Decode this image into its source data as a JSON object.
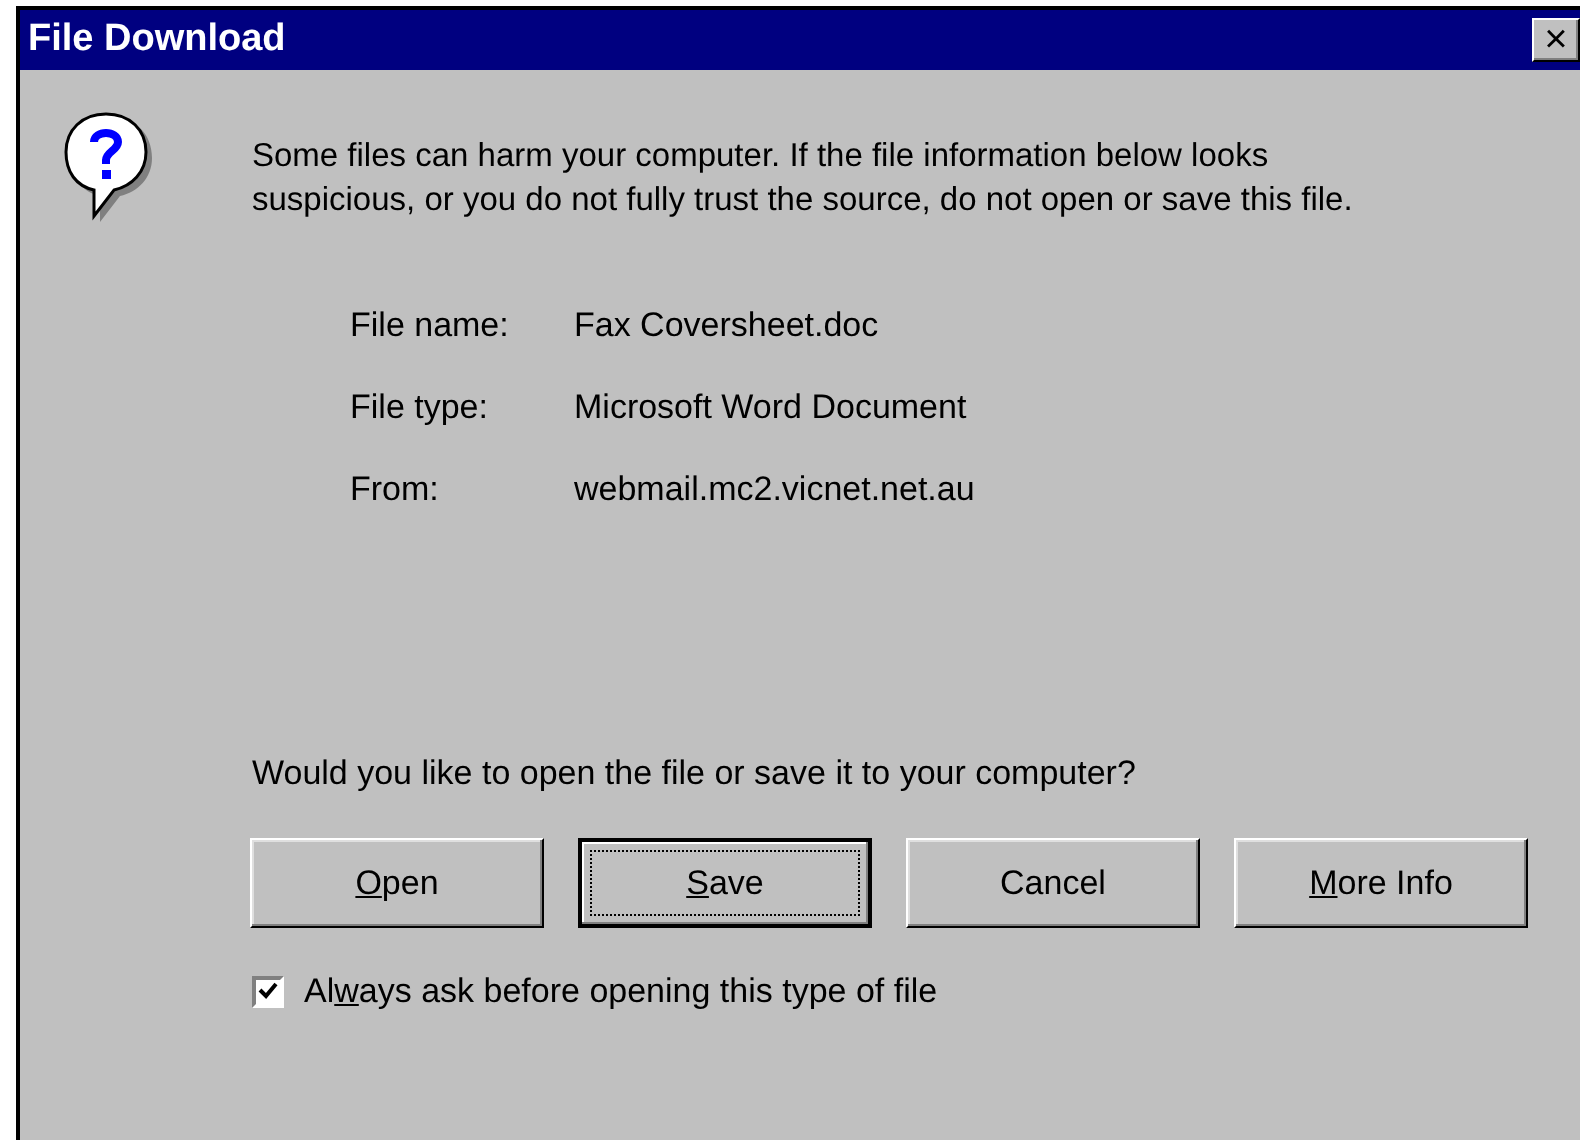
{
  "window": {
    "title": "File Download",
    "close_label": "×"
  },
  "warning": "Some files can harm your computer. If the file information below looks suspicious, or you do not fully trust the source, do not open or save this file.",
  "file_info": [
    {
      "label": "File name:",
      "value": "Fax Coversheet.doc"
    },
    {
      "label": "File type:",
      "value": "Microsoft Word Document"
    },
    {
      "label": "From:",
      "value": "webmail.mc2.vicnet.net.au"
    }
  ],
  "question": "Would you like to open the file or save it to your computer?",
  "buttons": [
    {
      "key": "O",
      "post": "pen",
      "default": false
    },
    {
      "key": "S",
      "post": "ave",
      "default": true
    },
    {
      "pre": "Cancel",
      "default": false
    },
    {
      "key": "M",
      "post": "ore Info",
      "default": false
    }
  ],
  "checkbox": {
    "pre": "Al",
    "key": "w",
    "post": "ays ask before opening this type of file",
    "checked": true
  }
}
